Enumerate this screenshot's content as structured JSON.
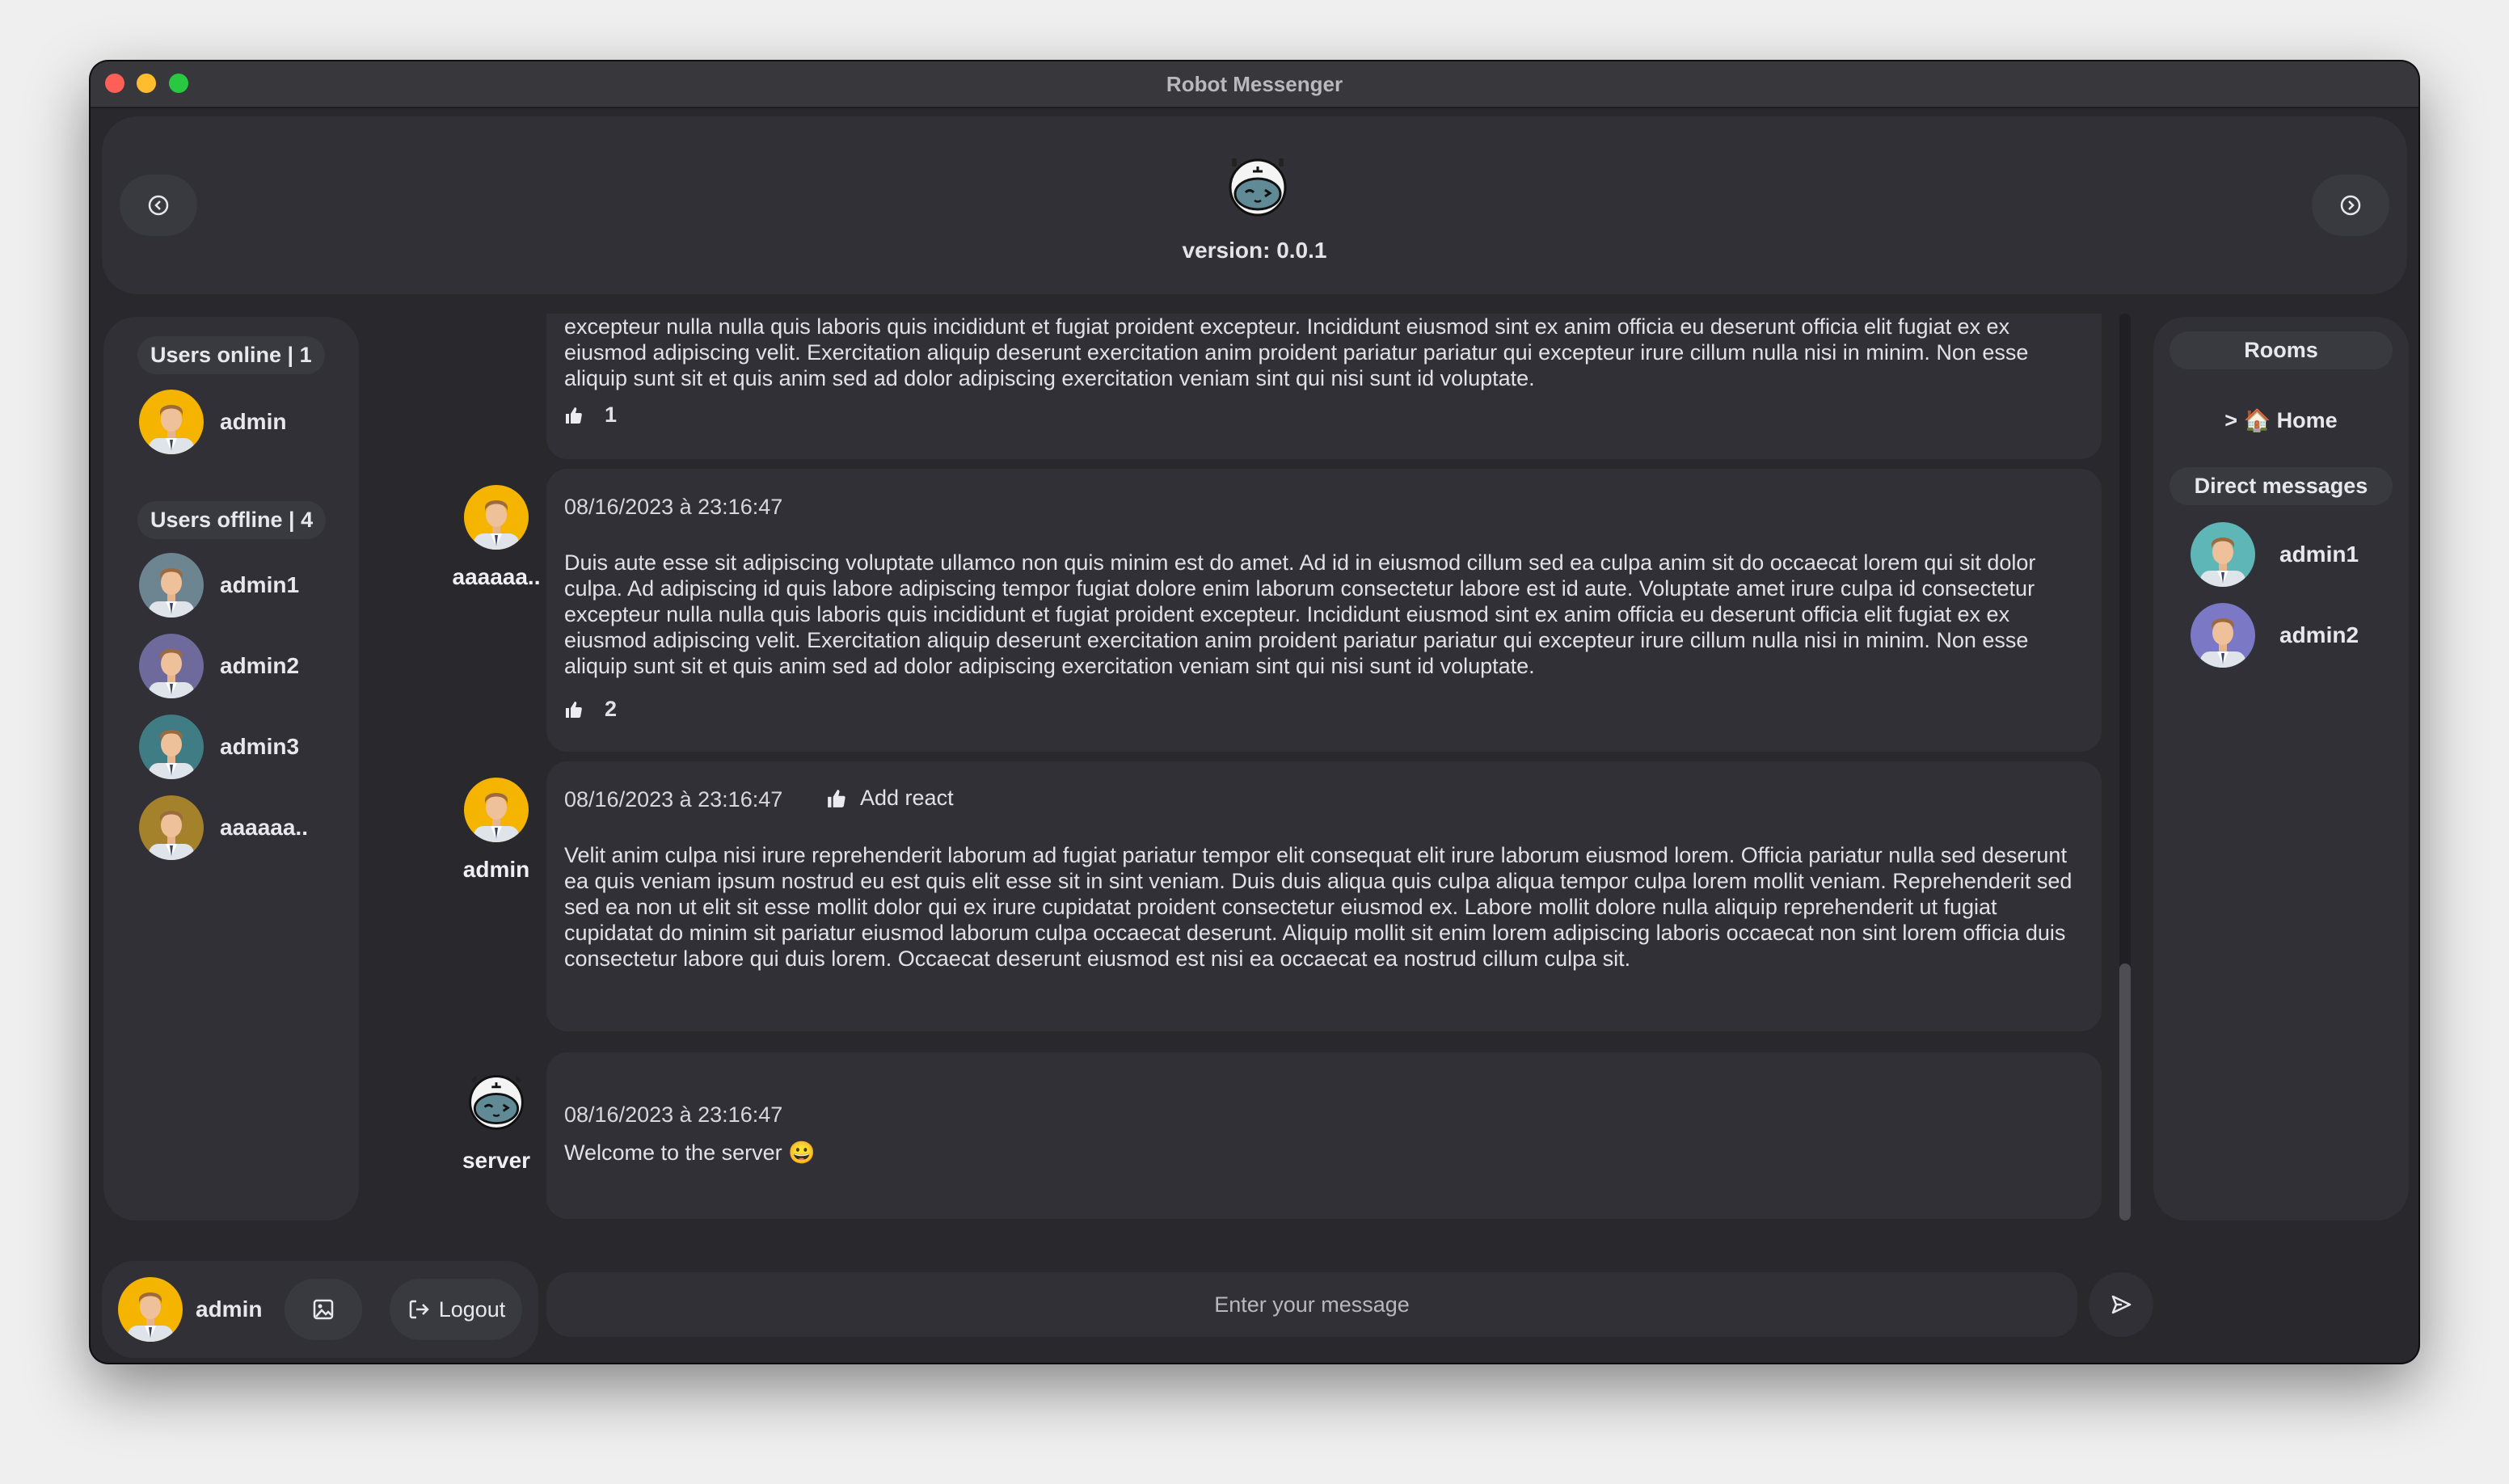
{
  "window": {
    "title": "Robot Messenger"
  },
  "header": {
    "version": "version: 0.0.1"
  },
  "online": {
    "header": "Users online | 1",
    "users": [
      {
        "name": "admin",
        "avatar_color": "#f4b400"
      }
    ]
  },
  "offline": {
    "header": "Users offline | 4",
    "users": [
      {
        "name": "admin1",
        "avatar_color": "#6d8591"
      },
      {
        "name": "admin2",
        "avatar_color": "#6f6a9c"
      },
      {
        "name": "admin3",
        "avatar_color": "#3f7c83"
      },
      {
        "name": "aaaaaa..",
        "avatar_color": "#a4822c"
      }
    ]
  },
  "rooms": {
    "header": "Rooms",
    "items": [
      {
        "label": "> 🏠 Home"
      }
    ]
  },
  "direct_messages": {
    "header": "Direct messages",
    "users": [
      {
        "name": "admin1",
        "avatar_color": "#5fb6b6"
      },
      {
        "name": "admin2",
        "avatar_color": "#7b79c6"
      }
    ]
  },
  "messages": [
    {
      "body": "excepteur nulla nulla quis laboris quis incididunt et fugiat proident excepteur. Incididunt eiusmod sint ex anim officia eu deserunt officia elit fugiat ex ex eiusmod adipiscing velit. Exercitation aliquip deserunt exercitation anim proident pariatur pariatur qui excepteur irure cillum nulla nisi in minim. Non esse aliquip sunt sit et quis anim sed ad dolor adipiscing exercitation veniam sint qui nisi sunt id voluptate.",
      "reactions": "1"
    },
    {
      "sender": "aaaaaa..",
      "time": "08/16/2023 à 23:16:47",
      "body": " Duis aute esse sit adipiscing voluptate ullamco non quis minim est do amet. Ad id in eiusmod cillum sed ea culpa anim sit do occaecat lorem qui sit dolor culpa. Ad adipiscing id quis labore adipiscing tempor fugiat dolore enim laborum consectetur labore est id aute. Voluptate amet irure culpa id consectetur excepteur nulla nulla quis laboris quis incididunt et fugiat proident excepteur. Incididunt eiusmod sint ex anim officia eu deserunt officia elit fugiat ex ex eiusmod adipiscing velit. Exercitation aliquip deserunt exercitation anim proident pariatur pariatur qui excepteur irure cillum nulla nisi in minim. Non esse aliquip sunt sit et quis anim sed ad dolor adipiscing exercitation veniam sint qui nisi sunt id voluptate.",
      "reactions": "2"
    },
    {
      "sender": "admin",
      "time": "08/16/2023 à 23:16:47",
      "add_react": "Add react",
      "body": " Velit anim culpa nisi irure reprehenderit laborum ad fugiat pariatur tempor elit consequat elit irure laborum eiusmod lorem. Officia pariatur nulla sed deserunt ea quis veniam ipsum nostrud eu est quis elit esse sit in sint veniam. Duis duis aliqua quis culpa aliqua tempor culpa lorem mollit veniam. Reprehenderit sed sed ea non ut elit sit esse mollit dolor qui ex irure cupidatat proident consectetur eiusmod ex. Labore mollit dolore nulla aliquip reprehenderit ut fugiat cupidatat do minim sit pariatur eiusmod laborum culpa occaecat deserunt. Aliquip mollit sit enim lorem adipiscing laboris occaecat non sint lorem officia duis consectetur labore qui duis lorem. Occaecat deserunt eiusmod est nisi ea occaecat ea nostrud cillum culpa sit."
    },
    {
      "sender": "server",
      "time": "08/16/2023 à 23:16:47",
      "body": "Welcome to the server 😀"
    }
  ],
  "composer": {
    "current_user": "admin",
    "logout_label": "Logout",
    "placeholder": "Enter your message"
  },
  "colors": {
    "background": "#28282d",
    "panel": "#303036",
    "pill": "#393940",
    "window_close": "#fe5f57",
    "window_minimize": "#febc2e",
    "window_zoom": "#28c840"
  }
}
